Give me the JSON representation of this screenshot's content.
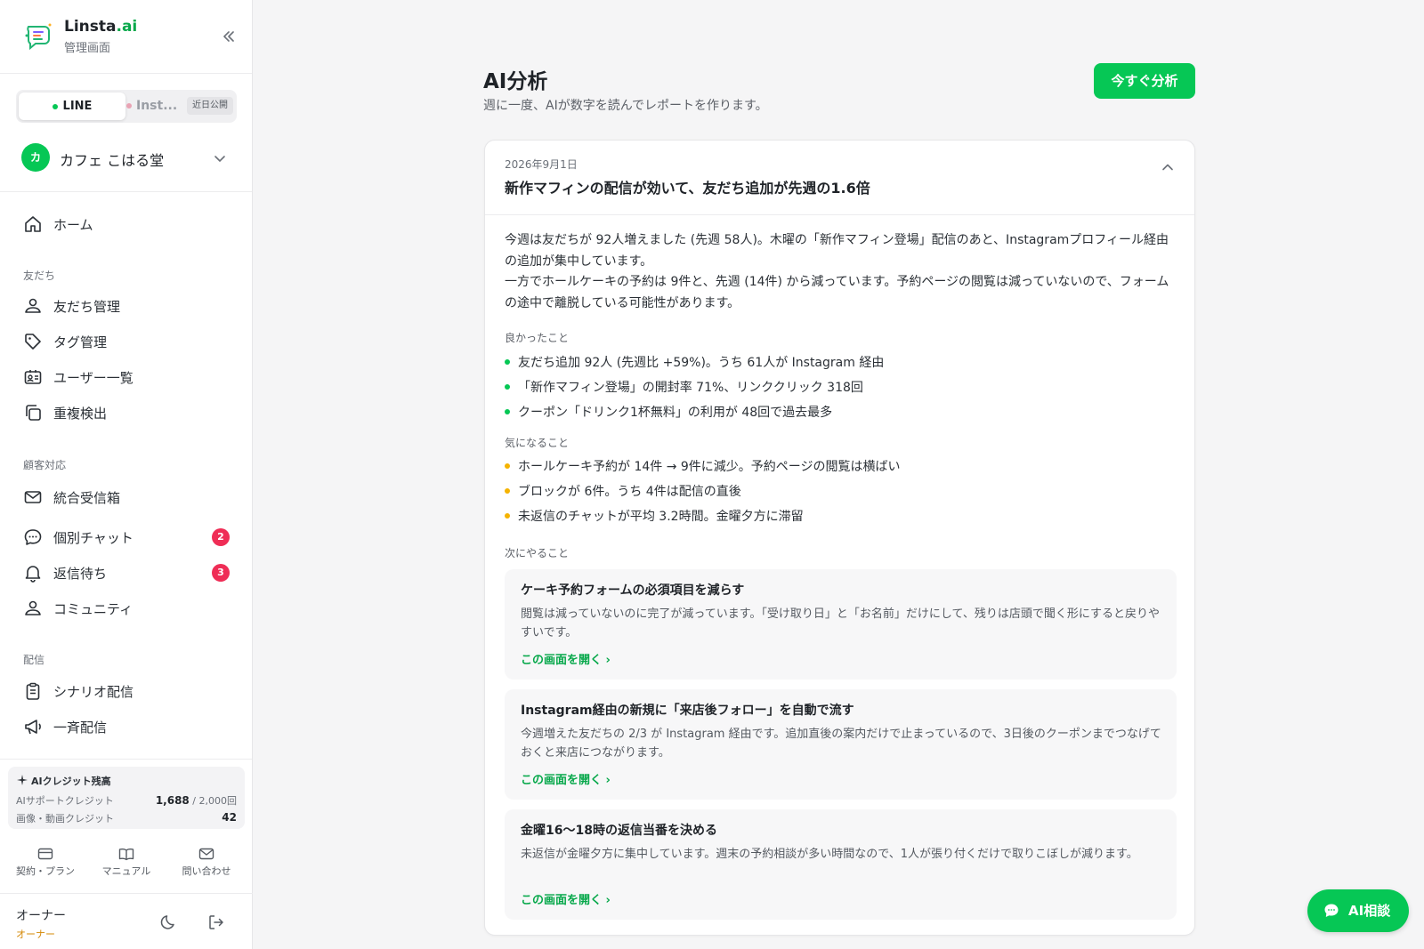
{
  "brand": {
    "name_main": "Linsta",
    "name_accent": ".ai",
    "subtitle": "管理画面"
  },
  "channels": {
    "line": "LINE",
    "instagram": "Inst...",
    "soon_badge": "近日公開"
  },
  "account": {
    "avatar_initial": "カ",
    "name": "カフェ こはる堂"
  },
  "nav": {
    "home": "ホーム",
    "section_friends": "友だち",
    "friends": "友だち管理",
    "tags": "タグ管理",
    "users": "ユーザー一覧",
    "duplicates": "重複検出",
    "section_support": "顧客対応",
    "inbox": "統合受信箱",
    "chat": "個別チャット",
    "chat_badge": "2",
    "waiting": "返信待ち",
    "waiting_badge": "3",
    "community": "コミュニティ",
    "section_broadcast": "配信",
    "scenario": "シナリオ配信",
    "broadcast": "一斉配信"
  },
  "credits": {
    "title": "AIクレジット残高",
    "support_label": "AIサポートクレジット",
    "support_value": "1,688",
    "support_total": " / 2,000回",
    "media_label": "画像・動画クレジット",
    "media_value": "42"
  },
  "footer_links": {
    "plan": "契約・プラン",
    "manual": "マニュアル",
    "contact": "問い合わせ"
  },
  "user": {
    "name": "オーナー",
    "role": "オーナー"
  },
  "page": {
    "title": "AI分析",
    "subtitle": "週に一度、AIが数字を読んでレポートを作ります。",
    "analyze_button": "今すぐ分析"
  },
  "report": {
    "date": "2026年9月1日",
    "headline": "新作マフィンの配信が効いて、友だち追加が先週の1.6倍",
    "summary_1": "今週は友だちが 92人増えました (先週 58人)。木曜の「新作マフィン登場」配信のあと、Instagramプロフィール経由の追加が集中しています。",
    "summary_2": "一方でホールケーキの予約は 9件と、先週 (14件) から減っています。予約ページの閲覧は減っていないので、フォームの途中で離脱している可能性があります。",
    "good_label": "良かったこと",
    "good": [
      "友だち追加 92人 (先週比 +59%)。うち 61人が Instagram 経由",
      "「新作マフィン登場」の開封率 71%、リンククリック 318回",
      "クーポン「ドリンク1杯無料」の利用が 48回で過去最多"
    ],
    "concern_label": "気になること",
    "concerns": [
      "ホールケーキ予約が 14件 → 9件に減少。予約ページの閲覧は横ばい",
      "ブロックが 6件。うち 4件は配信の直後",
      "未返信のチャットが平均 3.2時間。金曜夕方に滞留"
    ],
    "next_label": "次にやること",
    "actions": [
      {
        "title": "ケーキ予約フォームの必須項目を減らす",
        "body": "閲覧は減っていないのに完了が減っています。「受け取り日」と「お名前」だけにして、残りは店頭で聞く形にすると戻りやすいです。",
        "link": "この画面を開く"
      },
      {
        "title": "Instagram経由の新規に「来店後フォロー」を自動で流す",
        "body": "今週増えた友だちの 2/3 が Instagram 経由です。追加直後の案内だけで止まっているので、3日後のクーポンまでつなげておくと来店につながります。",
        "link": "この画面を開く"
      },
      {
        "title": "金曜16〜18時の返信当番を決める",
        "body": "未返信が金曜夕方に集中しています。週末の予約相談が多い時間なので、1人が張り付くだけで取りこぼしが減ります。",
        "link": "この画面を開く"
      }
    ]
  },
  "ai_chat_button": "AI相談",
  "colors": {
    "accent": "#06c755",
    "badge": "#ef2d56",
    "warn": "#f5b301"
  }
}
